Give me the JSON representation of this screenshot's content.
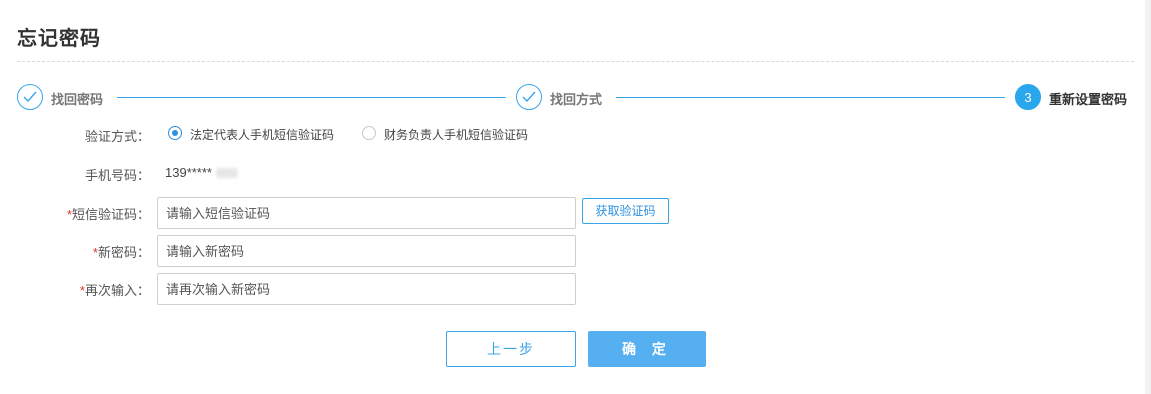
{
  "page": {
    "title": "忘记密码"
  },
  "steps": [
    {
      "label": "找回密码",
      "state": "done",
      "icon": "check-icon"
    },
    {
      "label": "找回方式",
      "state": "done",
      "icon": "check-icon"
    },
    {
      "label": "重新设置密码",
      "state": "active",
      "number": "3"
    }
  ],
  "form": {
    "verify_method": {
      "label": "验证方式：",
      "options": [
        {
          "label": "法定代表人手机短信验证码",
          "checked": true
        },
        {
          "label": "财务负责人手机短信验证码",
          "checked": false
        }
      ]
    },
    "phone": {
      "label": "手机号码：",
      "value": "139*****"
    },
    "sms_code": {
      "required_mark": "*",
      "label": "短信验证码：",
      "placeholder": "请输入短信验证码",
      "button": "获取验证码"
    },
    "new_password": {
      "required_mark": "*",
      "label": "新密码：",
      "placeholder": "请输入新密码"
    },
    "confirm_password": {
      "required_mark": "*",
      "label": "再次输入：",
      "placeholder": "请再次输入新密码"
    }
  },
  "actions": {
    "prev": "上一步",
    "confirm": "确 定"
  },
  "colors": {
    "accent": "#3aa6e8",
    "primary_button": "#55aff0",
    "required": "#e0352b"
  }
}
